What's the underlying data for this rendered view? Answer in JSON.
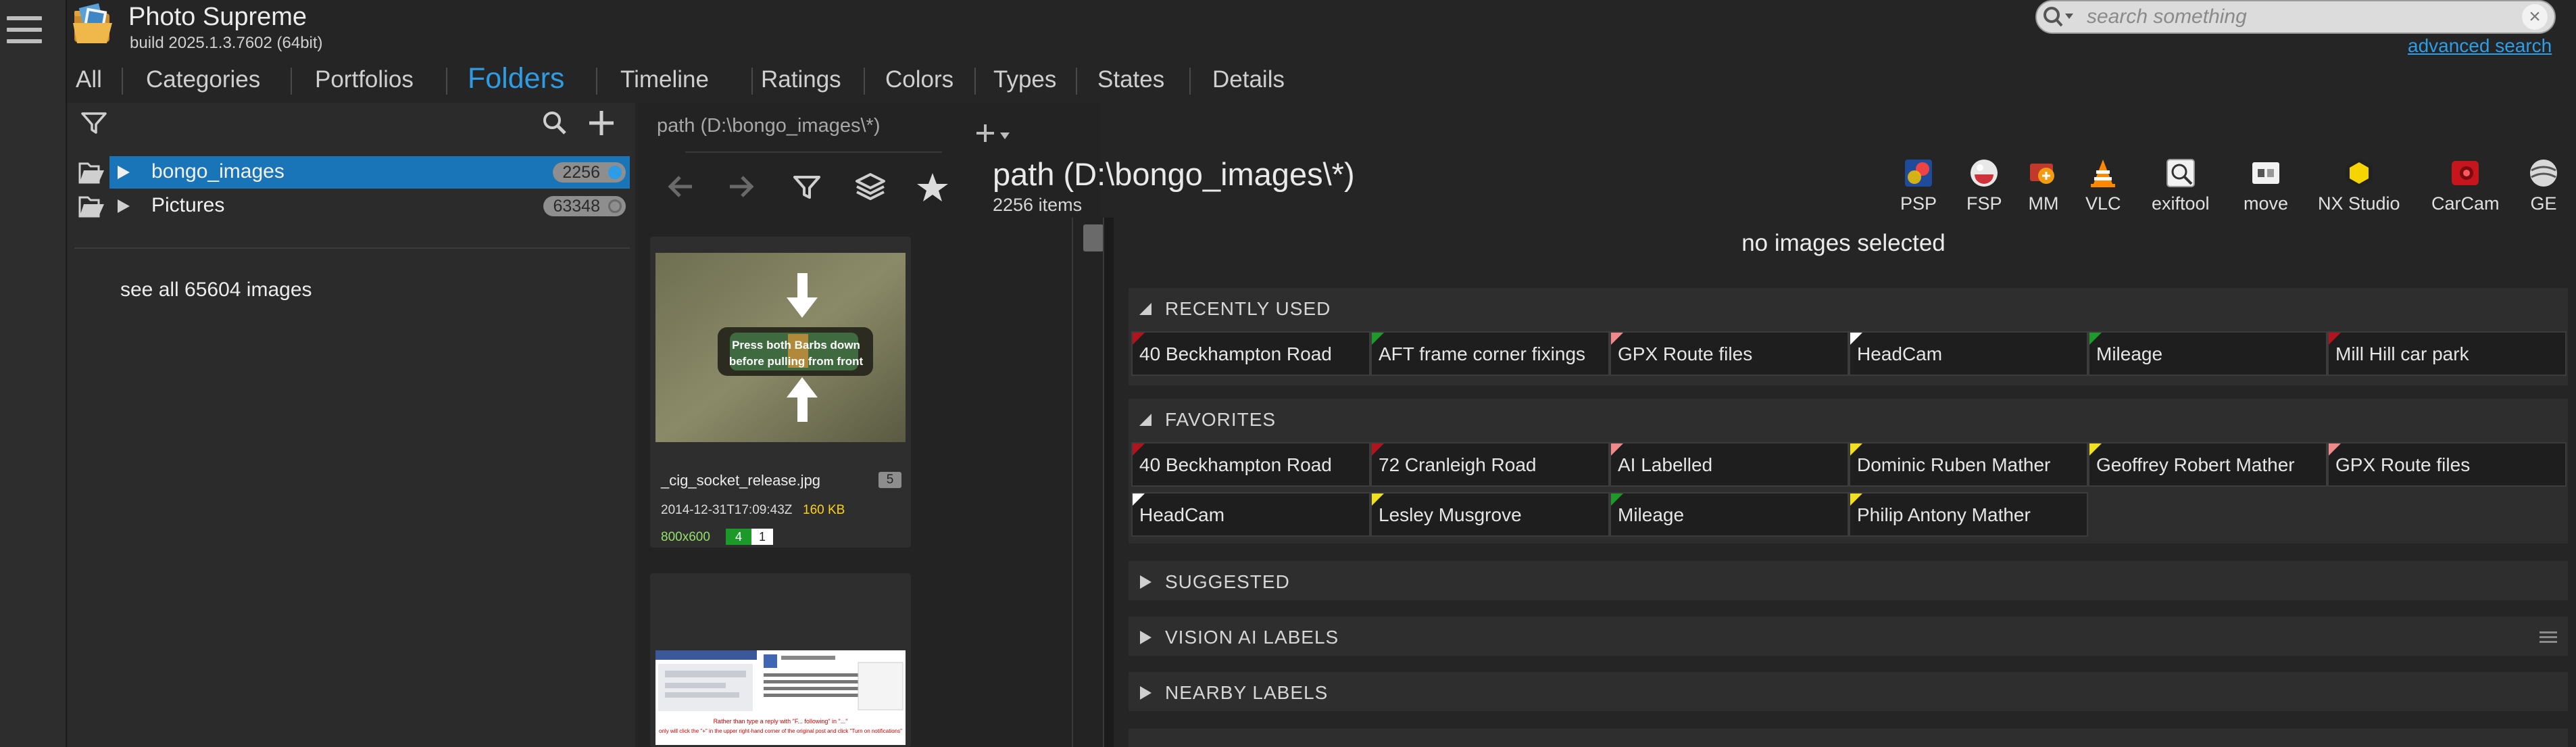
{
  "app": {
    "title": "Photo Supreme",
    "build": "build 2025.1.3.7602 (64bit)"
  },
  "search": {
    "placeholder": "search something",
    "clear": "×",
    "advanced_label": "advanced search"
  },
  "tabs": [
    "All",
    "Categories",
    "Portfolios",
    "Folders",
    "Timeline",
    "Ratings",
    "Colors",
    "Types",
    "States",
    "Details"
  ],
  "active_tab": "Folders",
  "folder_tree": {
    "items": [
      {
        "label": "bongo_images",
        "count": "2256",
        "selected": true,
        "dot_color": "#2d9be6"
      },
      {
        "label": "Pictures",
        "count": "63348",
        "selected": false,
        "dot_color": "#8e8e8e"
      }
    ],
    "see_all": "see all 65604 images"
  },
  "path_tab": "path (D:\\bongo_images\\*)",
  "main": {
    "title": "path (D:\\bongo_images\\*)",
    "count": "2256 items",
    "no_selection": "no images selected"
  },
  "tools": [
    {
      "label": "PSP",
      "icon": "psp-icon"
    },
    {
      "label": "FSP",
      "icon": "fsp-icon"
    },
    {
      "label": "MM",
      "icon": "mm-icon"
    },
    {
      "label": "VLC",
      "icon": "vlc-icon"
    },
    {
      "label": "exiftool",
      "icon": "exiftool-icon"
    },
    {
      "label": "move",
      "icon": "move-icon"
    },
    {
      "label": "NX Studio",
      "icon": "nx-studio-icon"
    },
    {
      "label": "CarCam",
      "icon": "carcam-icon"
    },
    {
      "label": "GE",
      "icon": "ge-icon"
    }
  ],
  "thumbnails": [
    {
      "filename": "_cig_socket_release.jpg",
      "badge": "5",
      "date": "2014-12-31T17:09:43Z",
      "size": "160 KB",
      "dimensions": "800x600",
      "version": "4",
      "version2": "1",
      "caption_line1": "Press both Barbs down",
      "caption_line2": "before pulling from front"
    },
    {
      "filename": "",
      "caption_line1": "Rather than type a reply with \"F... following\" in \"...\"",
      "caption_line2": "only will click the \"+\" in the upper right-hand corner of the original post and click \"Turn on notifications\""
    }
  ],
  "sections": {
    "recently_used": {
      "title": "RECENTLY USED",
      "labels": [
        {
          "text": "40 Beckhampton Road",
          "color": "#b0141e"
        },
        {
          "text": "AFT frame corner fixings",
          "color": "#1f9a2a"
        },
        {
          "text": "GPX Route files",
          "color": "#f08a8a"
        },
        {
          "text": "HeadCam",
          "color": "#ffffff"
        },
        {
          "text": "Mileage",
          "color": "#1f9a2a"
        },
        {
          "text": "Mill Hill car park",
          "color": "#b0141e"
        }
      ]
    },
    "favorites": {
      "title": "FAVORITES",
      "labels": [
        {
          "text": "40 Beckhampton Road",
          "color": "#b0141e"
        },
        {
          "text": "72 Cranleigh Road",
          "color": "#b0141e"
        },
        {
          "text": "AI Labelled",
          "color": "#f08a8a"
        },
        {
          "text": "Dominic Ruben Mather",
          "color": "#f0e020"
        },
        {
          "text": "Geoffrey Robert Mather",
          "color": "#f0e020"
        },
        {
          "text": "GPX Route files",
          "color": "#f08a8a"
        },
        {
          "text": "HeadCam",
          "color": "#ffffff"
        },
        {
          "text": "Lesley Musgrove",
          "color": "#f0e020"
        },
        {
          "text": "Mileage",
          "color": "#1f9a2a"
        },
        {
          "text": "Philip Antony Mather",
          "color": "#f0e020"
        }
      ]
    },
    "suggested": {
      "title": "SUGGESTED"
    },
    "vision_ai": {
      "title": "VISION AI LABELS"
    },
    "nearby": {
      "title": "NEARBY LABELS"
    }
  },
  "colors": {
    "accent": "#2f9be3",
    "selection": "#1a75b8",
    "link": "#2e9ee8"
  }
}
